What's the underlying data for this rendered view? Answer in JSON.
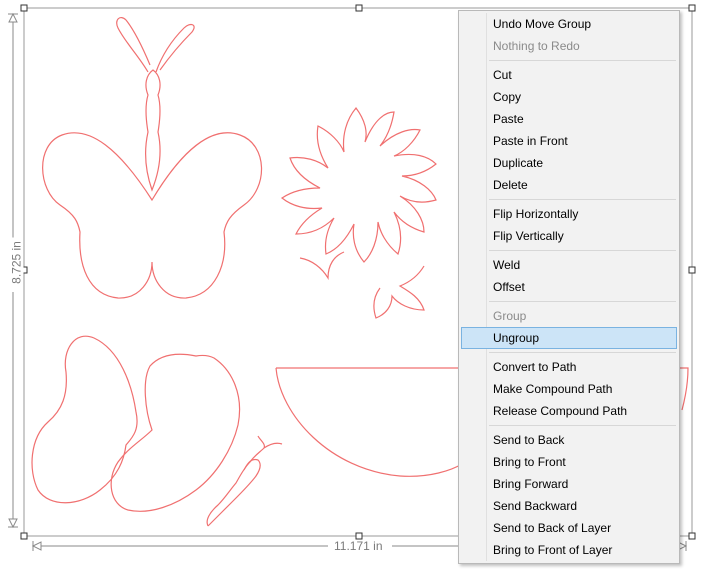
{
  "canvas": {
    "dimension_height": "8.725 in",
    "dimension_width": "11.171 in",
    "cut_line_color": "#f07070"
  },
  "context_menu": {
    "groups": [
      [
        {
          "label": "Undo Move Group",
          "enabled": true
        },
        {
          "label": "Nothing to Redo",
          "enabled": false
        }
      ],
      [
        {
          "label": "Cut",
          "enabled": true
        },
        {
          "label": "Copy",
          "enabled": true
        },
        {
          "label": "Paste",
          "enabled": true
        },
        {
          "label": "Paste in Front",
          "enabled": true
        },
        {
          "label": "Duplicate",
          "enabled": true
        },
        {
          "label": "Delete",
          "enabled": true
        }
      ],
      [
        {
          "label": "Flip Horizontally",
          "enabled": true
        },
        {
          "label": "Flip Vertically",
          "enabled": true
        }
      ],
      [
        {
          "label": "Weld",
          "enabled": true
        },
        {
          "label": "Offset",
          "enabled": true
        }
      ],
      [
        {
          "label": "Group",
          "enabled": false
        },
        {
          "label": "Ungroup",
          "enabled": true,
          "highlighted": true
        }
      ],
      [
        {
          "label": "Convert to Path",
          "enabled": true
        },
        {
          "label": "Make Compound Path",
          "enabled": true
        },
        {
          "label": "Release Compound Path",
          "enabled": true
        }
      ],
      [
        {
          "label": "Send to Back",
          "enabled": true
        },
        {
          "label": "Bring to Front",
          "enabled": true
        },
        {
          "label": "Bring Forward",
          "enabled": true
        },
        {
          "label": "Send Backward",
          "enabled": true
        },
        {
          "label": "Send to Back of Layer",
          "enabled": true
        },
        {
          "label": "Bring to Front of Layer",
          "enabled": true
        }
      ]
    ],
    "hover_color": "#cce4f7"
  }
}
